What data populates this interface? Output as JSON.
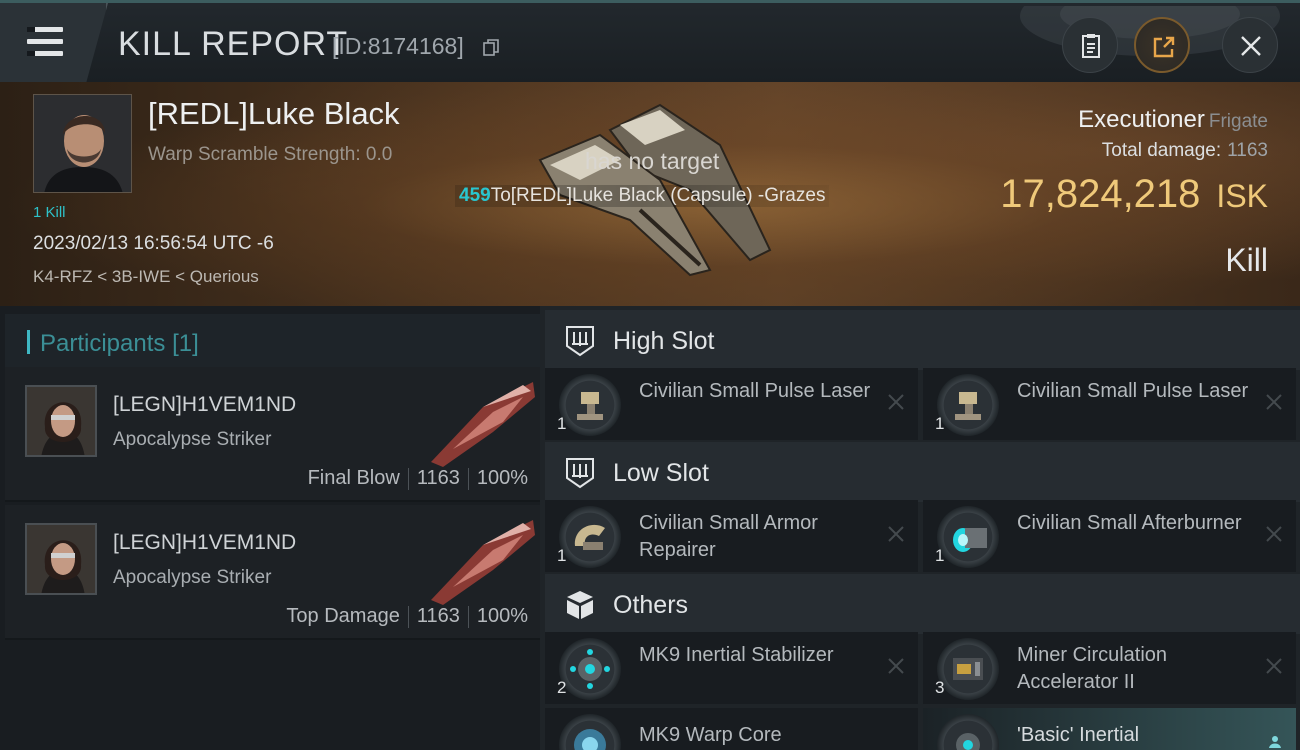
{
  "header": {
    "title": "KILL REPORT",
    "report_id": "[ID:8174168]"
  },
  "victim": {
    "name": "[REDL]Luke Black",
    "warp_scramble": "Warp Scramble Strength: 0.0",
    "kills": "1 Kill",
    "datetime": "2023/02/13 16:56:54 UTC -6",
    "route": "K4-RFZ < 3B-IWE < Querious",
    "ship_name": "Executioner",
    "ship_class": "Frigate",
    "total_damage_label": "Total damage:",
    "total_damage": "1163",
    "isk_value": "17,824,218",
    "isk_unit": "ISK",
    "result": "Kill"
  },
  "combat_log": {
    "no_target": "has no target",
    "damage_amount": "459",
    "damage_text": "To[REDL]Luke Black (Capsule) -Grazes"
  },
  "participants": {
    "title": "Participants",
    "count": "[1]",
    "rows": [
      {
        "name": "[LEGN]H1VEM1ND",
        "ship": "Apocalypse Striker",
        "label": "Final Blow",
        "damage": "1163",
        "percent": "100%"
      },
      {
        "name": "[LEGN]H1VEM1ND",
        "ship": "Apocalypse Striker",
        "label": "Top Damage",
        "damage": "1163",
        "percent": "100%"
      }
    ]
  },
  "fitting": {
    "high_slot": {
      "label": "High Slot",
      "items": [
        {
          "name": "Civilian Small Pulse Laser",
          "qty": "1"
        },
        {
          "name": "Civilian Small Pulse Laser",
          "qty": "1"
        }
      ]
    },
    "low_slot": {
      "label": "Low Slot",
      "items": [
        {
          "name": "Civilian Small Armor Repairer",
          "qty": "1"
        },
        {
          "name": "Civilian Small Afterburner",
          "qty": "1"
        }
      ]
    },
    "others": {
      "label": "Others",
      "items": [
        {
          "name": "MK9 Inertial Stabilizer",
          "qty": "2"
        },
        {
          "name": "Miner Circulation Accelerator II",
          "qty": "3"
        },
        {
          "name": "MK9 Warp Core",
          "qty": ""
        },
        {
          "name": "'Basic' Inertial",
          "qty": ""
        }
      ]
    }
  },
  "colors": {
    "accent_cyan": "#2ec2c9",
    "isk_gold": "#efc97a",
    "banner_brown": "#4f3620"
  },
  "icons": [
    "menu-icon",
    "copy-icon",
    "clipboard-icon",
    "share-icon",
    "close-icon",
    "high-slot-icon",
    "low-slot-icon",
    "others-cube-icon",
    "remove-icon"
  ]
}
